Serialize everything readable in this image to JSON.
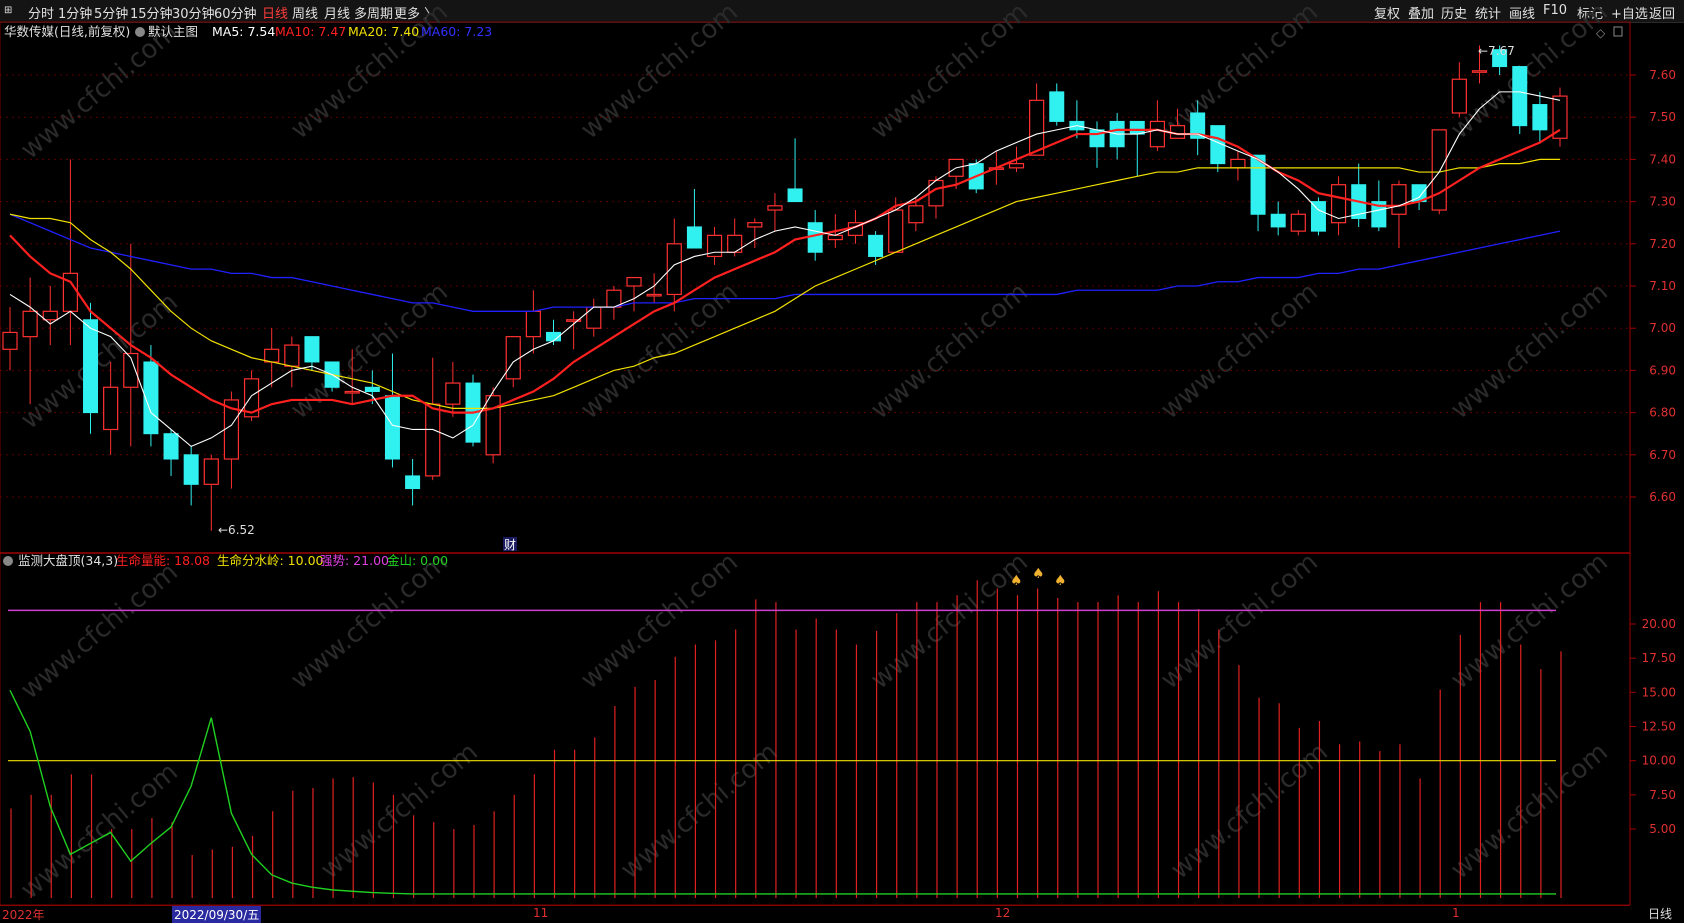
{
  "toolbar": {
    "menu_icon": "expand-icon",
    "periods": [
      "分时",
      "1分钟",
      "5分钟",
      "15分钟",
      "30分钟",
      "60分钟",
      "日线",
      "周线",
      "月线",
      "多周期",
      "更多 〉"
    ],
    "active_period": "日线",
    "right_buttons": [
      "复权",
      "叠加",
      "历史",
      "统计",
      "画线",
      "F10",
      "标记",
      "+自选",
      "返回"
    ]
  },
  "stock_header": {
    "name": "华数传媒(日线,前复权)",
    "indicator": "默认主图",
    "ma5": "MA5: 7.54",
    "ma10": "MA10: 7.47",
    "ma20": "MA20: 7.40",
    "ma60": "MA60: 7.23",
    "colors": {
      "ma5": "#ffffff",
      "ma10": "#ff2020",
      "ma20": "#f0e000",
      "ma60": "#3030ff"
    }
  },
  "sub_header": {
    "name": "监测大盘顶(34,3)",
    "life_energy": "生命量能: 18.08",
    "watershed": "生命分水岭: 10.00",
    "strength": "强势: 21.00",
    "gold": "金山: 0.00",
    "colors": {
      "life_energy": "#ff2020",
      "watershed": "#f0e000",
      "strength": "#e040e0",
      "gold": "#20d020"
    }
  },
  "main_axis": [
    "7.60",
    "7.50",
    "7.40",
    "7.30",
    "7.20",
    "7.10",
    "7.00",
    "6.90",
    "6.80",
    "6.70",
    "6.60"
  ],
  "sub_axis": [
    "20.00",
    "17.50",
    "15.00",
    "12.50",
    "10.00",
    "7.50",
    "5.00"
  ],
  "annotations": {
    "low": "6.52",
    "high": "7.67",
    "fin_marker": "财"
  },
  "dates": {
    "year": "2022年",
    "selected": "2022/09/30/五",
    "nov": "11",
    "dec": "12",
    "jan": "1"
  },
  "period_button": "日线",
  "watermark_text": "www.cfchi.com",
  "chart_data": {
    "type": "candlestick",
    "main": {
      "ylim": [
        6.5,
        7.7
      ],
      "candles": [
        {
          "o": 6.95,
          "h": 7.05,
          "l": 6.9,
          "c": 6.99
        },
        {
          "o": 6.98,
          "h": 7.12,
          "l": 6.82,
          "c": 7.04
        },
        {
          "o": 7.02,
          "h": 7.1,
          "l": 6.96,
          "c": 7.04
        },
        {
          "o": 7.04,
          "h": 7.4,
          "l": 6.96,
          "c": 7.13
        },
        {
          "o": 7.02,
          "h": 7.06,
          "l": 6.75,
          "c": 6.8
        },
        {
          "o": 6.76,
          "h": 6.92,
          "l": 6.7,
          "c": 6.86
        },
        {
          "o": 6.86,
          "h": 7.2,
          "l": 6.72,
          "c": 6.94
        },
        {
          "o": 6.92,
          "h": 6.96,
          "l": 6.72,
          "c": 6.75
        },
        {
          "o": 6.75,
          "h": 6.76,
          "l": 6.65,
          "c": 6.69
        },
        {
          "o": 6.7,
          "h": 6.72,
          "l": 6.58,
          "c": 6.63
        },
        {
          "o": 6.63,
          "h": 6.7,
          "l": 6.52,
          "c": 6.69
        },
        {
          "o": 6.69,
          "h": 6.85,
          "l": 6.62,
          "c": 6.83
        },
        {
          "o": 6.79,
          "h": 6.9,
          "l": 6.78,
          "c": 6.88
        },
        {
          "o": 6.92,
          "h": 7.0,
          "l": 6.86,
          "c": 6.95
        },
        {
          "o": 6.91,
          "h": 6.98,
          "l": 6.86,
          "c": 6.96
        },
        {
          "o": 6.98,
          "h": 6.98,
          "l": 6.9,
          "c": 6.92
        },
        {
          "o": 6.92,
          "h": 6.92,
          "l": 6.85,
          "c": 6.86
        },
        {
          "o": 6.85,
          "h": 6.95,
          "l": 6.82,
          "c": 6.85
        },
        {
          "o": 6.86,
          "h": 6.9,
          "l": 6.82,
          "c": 6.85
        },
        {
          "o": 6.84,
          "h": 6.94,
          "l": 6.67,
          "c": 6.69
        },
        {
          "o": 6.65,
          "h": 6.69,
          "l": 6.58,
          "c": 6.62
        },
        {
          "o": 6.65,
          "h": 6.93,
          "l": 6.64,
          "c": 6.82
        },
        {
          "o": 6.82,
          "h": 6.92,
          "l": 6.79,
          "c": 6.87
        },
        {
          "o": 6.87,
          "h": 6.89,
          "l": 6.72,
          "c": 6.73
        },
        {
          "o": 6.7,
          "h": 6.86,
          "l": 6.68,
          "c": 6.84
        },
        {
          "o": 6.88,
          "h": 6.98,
          "l": 6.86,
          "c": 6.98
        },
        {
          "o": 6.98,
          "h": 7.09,
          "l": 6.94,
          "c": 7.04
        },
        {
          "o": 6.99,
          "h": 7.02,
          "l": 6.96,
          "c": 6.97
        },
        {
          "o": 7.02,
          "h": 7.04,
          "l": 6.95,
          "c": 7.02
        },
        {
          "o": 7.0,
          "h": 7.07,
          "l": 6.98,
          "c": 7.05
        },
        {
          "o": 7.05,
          "h": 7.1,
          "l": 7.02,
          "c": 7.09
        },
        {
          "o": 7.1,
          "h": 7.12,
          "l": 7.04,
          "c": 7.12
        },
        {
          "o": 7.08,
          "h": 7.13,
          "l": 7.06,
          "c": 7.08
        },
        {
          "o": 7.08,
          "h": 7.26,
          "l": 7.04,
          "c": 7.2
        },
        {
          "o": 7.24,
          "h": 7.33,
          "l": 7.21,
          "c": 7.19
        },
        {
          "o": 7.17,
          "h": 7.24,
          "l": 7.15,
          "c": 7.22
        },
        {
          "o": 7.18,
          "h": 7.26,
          "l": 7.17,
          "c": 7.22
        },
        {
          "o": 7.24,
          "h": 7.26,
          "l": 7.19,
          "c": 7.25
        },
        {
          "o": 7.28,
          "h": 7.32,
          "l": 7.23,
          "c": 7.29
        },
        {
          "o": 7.33,
          "h": 7.45,
          "l": 7.3,
          "c": 7.3
        },
        {
          "o": 7.25,
          "h": 7.28,
          "l": 7.16,
          "c": 7.18
        },
        {
          "o": 7.21,
          "h": 7.27,
          "l": 7.19,
          "c": 7.22
        },
        {
          "o": 7.22,
          "h": 7.28,
          "l": 7.2,
          "c": 7.25
        },
        {
          "o": 7.22,
          "h": 7.23,
          "l": 7.15,
          "c": 7.17
        },
        {
          "o": 7.18,
          "h": 7.31,
          "l": 7.18,
          "c": 7.28
        },
        {
          "o": 7.25,
          "h": 7.31,
          "l": 7.23,
          "c": 7.29
        },
        {
          "o": 7.29,
          "h": 7.36,
          "l": 7.26,
          "c": 7.35
        },
        {
          "o": 7.36,
          "h": 7.4,
          "l": 7.33,
          "c": 7.4
        },
        {
          "o": 7.39,
          "h": 7.4,
          "l": 7.32,
          "c": 7.33
        },
        {
          "o": 7.38,
          "h": 7.42,
          "l": 7.34,
          "c": 7.38
        },
        {
          "o": 7.38,
          "h": 7.43,
          "l": 7.37,
          "c": 7.39
        },
        {
          "o": 7.41,
          "h": 7.58,
          "l": 7.41,
          "c": 7.54
        },
        {
          "o": 7.56,
          "h": 7.58,
          "l": 7.48,
          "c": 7.49
        },
        {
          "o": 7.49,
          "h": 7.54,
          "l": 7.45,
          "c": 7.47
        },
        {
          "o": 7.47,
          "h": 7.49,
          "l": 7.38,
          "c": 7.43
        },
        {
          "o": 7.49,
          "h": 7.51,
          "l": 7.4,
          "c": 7.43
        },
        {
          "o": 7.49,
          "h": 7.49,
          "l": 7.36,
          "c": 7.46
        },
        {
          "o": 7.43,
          "h": 7.54,
          "l": 7.42,
          "c": 7.49
        },
        {
          "o": 7.45,
          "h": 7.52,
          "l": 7.45,
          "c": 7.48
        },
        {
          "o": 7.51,
          "h": 7.54,
          "l": 7.41,
          "c": 7.45
        },
        {
          "o": 7.48,
          "h": 7.48,
          "l": 7.37,
          "c": 7.39
        },
        {
          "o": 7.38,
          "h": 7.42,
          "l": 7.35,
          "c": 7.4
        },
        {
          "o": 7.41,
          "h": 7.41,
          "l": 7.23,
          "c": 7.27
        },
        {
          "o": 7.27,
          "h": 7.3,
          "l": 7.22,
          "c": 7.24
        },
        {
          "o": 7.23,
          "h": 7.28,
          "l": 7.22,
          "c": 7.27
        },
        {
          "o": 7.3,
          "h": 7.31,
          "l": 7.22,
          "c": 7.23
        },
        {
          "o": 7.25,
          "h": 7.36,
          "l": 7.22,
          "c": 7.34
        },
        {
          "o": 7.34,
          "h": 7.39,
          "l": 7.24,
          "c": 7.26
        },
        {
          "o": 7.3,
          "h": 7.35,
          "l": 7.23,
          "c": 7.24
        },
        {
          "o": 7.27,
          "h": 7.35,
          "l": 7.19,
          "c": 7.34
        },
        {
          "o": 7.34,
          "h": 7.34,
          "l": 7.28,
          "c": 7.3
        },
        {
          "o": 7.28,
          "h": 7.47,
          "l": 7.27,
          "c": 7.47
        },
        {
          "o": 7.51,
          "h": 7.63,
          "l": 7.5,
          "c": 7.59
        },
        {
          "o": 7.61,
          "h": 7.67,
          "l": 7.58,
          "c": 7.61
        },
        {
          "o": 7.66,
          "h": 7.67,
          "l": 7.6,
          "c": 7.62
        },
        {
          "o": 7.62,
          "h": 7.62,
          "l": 7.46,
          "c": 7.48
        },
        {
          "o": 7.53,
          "h": 7.56,
          "l": 7.44,
          "c": 7.47
        },
        {
          "o": 7.45,
          "h": 7.57,
          "l": 7.43,
          "c": 7.55
        }
      ],
      "ma5": [
        7.08,
        7.05,
        7.01,
        7.04,
        7.0,
        6.98,
        6.93,
        6.8,
        6.76,
        6.72,
        6.74,
        6.77,
        6.84,
        6.87,
        6.9,
        6.91,
        6.89,
        6.86,
        6.84,
        6.77,
        6.76,
        6.76,
        6.74,
        6.77,
        6.85,
        6.92,
        6.95,
        6.97,
        7.01,
        7.05,
        7.05,
        7.07,
        7.1,
        7.15,
        7.17,
        7.18,
        7.18,
        7.21,
        7.23,
        7.24,
        7.23,
        7.22,
        7.24,
        7.26,
        7.28,
        7.31,
        7.35,
        7.38,
        7.39,
        7.42,
        7.44,
        7.46,
        7.47,
        7.48,
        7.47,
        7.46,
        7.46,
        7.47,
        7.46,
        7.46,
        7.44,
        7.42,
        7.4,
        7.37,
        7.33,
        7.28,
        7.26,
        7.27,
        7.28,
        7.29,
        7.31,
        7.37,
        7.46,
        7.52,
        7.56,
        7.56,
        7.55,
        7.54
      ],
      "ma10": [
        7.22,
        7.17,
        7.13,
        7.11,
        7.04,
        7.0,
        6.96,
        6.93,
        6.89,
        6.86,
        6.83,
        6.81,
        6.8,
        6.82,
        6.83,
        6.83,
        6.83,
        6.82,
        6.83,
        6.84,
        6.84,
        6.81,
        6.8,
        6.8,
        6.81,
        6.83,
        6.85,
        6.88,
        6.92,
        6.95,
        6.98,
        7.01,
        7.04,
        7.06,
        7.09,
        7.12,
        7.14,
        7.16,
        7.18,
        7.21,
        7.22,
        7.23,
        7.24,
        7.26,
        7.29,
        7.3,
        7.33,
        7.34,
        7.36,
        7.38,
        7.4,
        7.42,
        7.44,
        7.46,
        7.46,
        7.47,
        7.47,
        7.47,
        7.46,
        7.46,
        7.45,
        7.43,
        7.4,
        7.37,
        7.35,
        7.32,
        7.31,
        7.3,
        7.29,
        7.29,
        7.3,
        7.32,
        7.35,
        7.38,
        7.4,
        7.42,
        7.44,
        7.47
      ],
      "ma20": [
        7.27,
        7.26,
        7.26,
        7.25,
        7.21,
        7.18,
        7.14,
        7.09,
        7.04,
        7.0,
        6.97,
        6.95,
        6.93,
        6.92,
        6.91,
        6.9,
        6.89,
        6.88,
        6.87,
        6.85,
        6.83,
        6.82,
        6.81,
        6.81,
        6.81,
        6.82,
        6.83,
        6.84,
        6.86,
        6.88,
        6.9,
        6.91,
        6.93,
        6.94,
        6.96,
        6.98,
        7.0,
        7.02,
        7.04,
        7.07,
        7.1,
        7.12,
        7.14,
        7.16,
        7.18,
        7.2,
        7.22,
        7.24,
        7.26,
        7.28,
        7.3,
        7.31,
        7.32,
        7.33,
        7.34,
        7.35,
        7.36,
        7.37,
        7.37,
        7.38,
        7.38,
        7.38,
        7.38,
        7.38,
        7.38,
        7.38,
        7.38,
        7.38,
        7.38,
        7.38,
        7.37,
        7.37,
        7.38,
        7.38,
        7.39,
        7.39,
        7.4,
        7.4
      ],
      "ma60": [
        7.27,
        7.25,
        7.23,
        7.21,
        7.19,
        7.18,
        7.17,
        7.16,
        7.15,
        7.14,
        7.14,
        7.13,
        7.13,
        7.12,
        7.12,
        7.11,
        7.1,
        7.09,
        7.08,
        7.07,
        7.06,
        7.06,
        7.05,
        7.04,
        7.04,
        7.04,
        7.04,
        7.05,
        7.05,
        7.05,
        7.05,
        7.06,
        7.06,
        7.06,
        7.07,
        7.07,
        7.07,
        7.07,
        7.07,
        7.08,
        7.08,
        7.08,
        7.08,
        7.08,
        7.08,
        7.08,
        7.08,
        7.08,
        7.08,
        7.08,
        7.08,
        7.08,
        7.08,
        7.09,
        7.09,
        7.09,
        7.09,
        7.09,
        7.1,
        7.1,
        7.11,
        7.11,
        7.12,
        7.12,
        7.12,
        7.13,
        7.13,
        7.14,
        7.14,
        7.15,
        7.16,
        7.17,
        7.18,
        7.19,
        7.2,
        7.21,
        7.22,
        7.23
      ]
    },
    "sub": {
      "ylim": [
        0,
        25
      ],
      "bars": [
        6.5,
        7.5,
        7.5,
        9,
        9,
        5,
        5,
        5.8,
        5.5,
        3.1,
        3.5,
        3.7,
        4.5,
        6.3,
        7.8,
        8,
        8.7,
        8.8,
        8.4,
        7.5,
        6,
        5.5,
        5,
        5.3,
        6.3,
        7.5,
        9,
        10.8,
        10.8,
        11.7,
        14,
        15.4,
        15.9,
        17.6,
        18.5,
        18.8,
        19.6,
        21.8,
        21.6,
        19.6,
        20.4,
        19.6,
        18.5,
        19.5,
        20.8,
        21.6,
        21.6,
        22.1,
        23.2,
        22.6,
        22.1,
        22.6,
        21.9,
        21.6,
        21.6,
        22.1,
        21.6,
        22.4,
        21.6,
        21.1,
        19.6,
        17,
        14.6,
        14.2,
        12.4,
        12.9,
        11.2,
        11.4,
        10.7,
        11.2,
        8.7,
        15.2,
        19.2,
        21.6,
        21.6,
        18.5,
        16.7,
        18
      ],
      "life_line": [
        15,
        12,
        6.5,
        3,
        3.8,
        4.6,
        2.5,
        3.8,
        5,
        8,
        13,
        6,
        3,
        1.5,
        0.9,
        0.6,
        0.4,
        0.3,
        0.2,
        0.15,
        0.1,
        0.1,
        0.1,
        0.1
      ],
      "watershed": 10,
      "strength": 21
    }
  }
}
